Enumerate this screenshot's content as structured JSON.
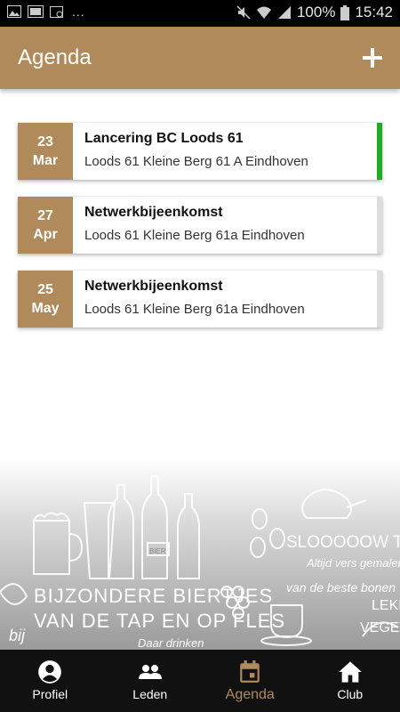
{
  "status_bar": {
    "battery": "100%",
    "time": "15:42",
    "overflow": "..."
  },
  "header": {
    "title": "Agenda",
    "add_icon": "plus-icon"
  },
  "events": [
    {
      "day": "23",
      "month": "Mar",
      "title": "Lancering BC Loods 61",
      "location": "Loods 61 Kleine Berg 61 A Eindhoven",
      "active": true
    },
    {
      "day": "27",
      "month": "Apr",
      "title": "Netwerkbijeenkomst",
      "location": "Loods 61 Kleine Berg 61a Eindhoven",
      "active": false
    },
    {
      "day": "25",
      "month": "May",
      "title": "Netwerkbijeenkomst",
      "location": "Loods 61 Kleine Berg 61a Eindhoven",
      "active": false
    }
  ],
  "background_art": {
    "texts": [
      "SLOOOOOW TEA",
      "BIJZONDERE BIERTJES",
      "VAN DE TAP EN OP FLES",
      "Altijd vers gemalen",
      "van de beste bonen",
      "LEKK",
      "VEGETA",
      "BIER",
      "bij",
      "Daar drinken"
    ]
  },
  "bottom_nav": [
    {
      "label": "Profiel",
      "icon": "account-circle-icon",
      "active": false
    },
    {
      "label": "Leden",
      "icon": "people-icon",
      "active": false
    },
    {
      "label": "Agenda",
      "icon": "calendar-icon",
      "active": true
    },
    {
      "label": "Club",
      "icon": "home-icon",
      "active": false
    }
  ],
  "colors": {
    "brand": "#b08a5a",
    "active_indicator": "#1faa2a",
    "inactive_indicator": "#dddddd",
    "nav_background": "#111111"
  }
}
